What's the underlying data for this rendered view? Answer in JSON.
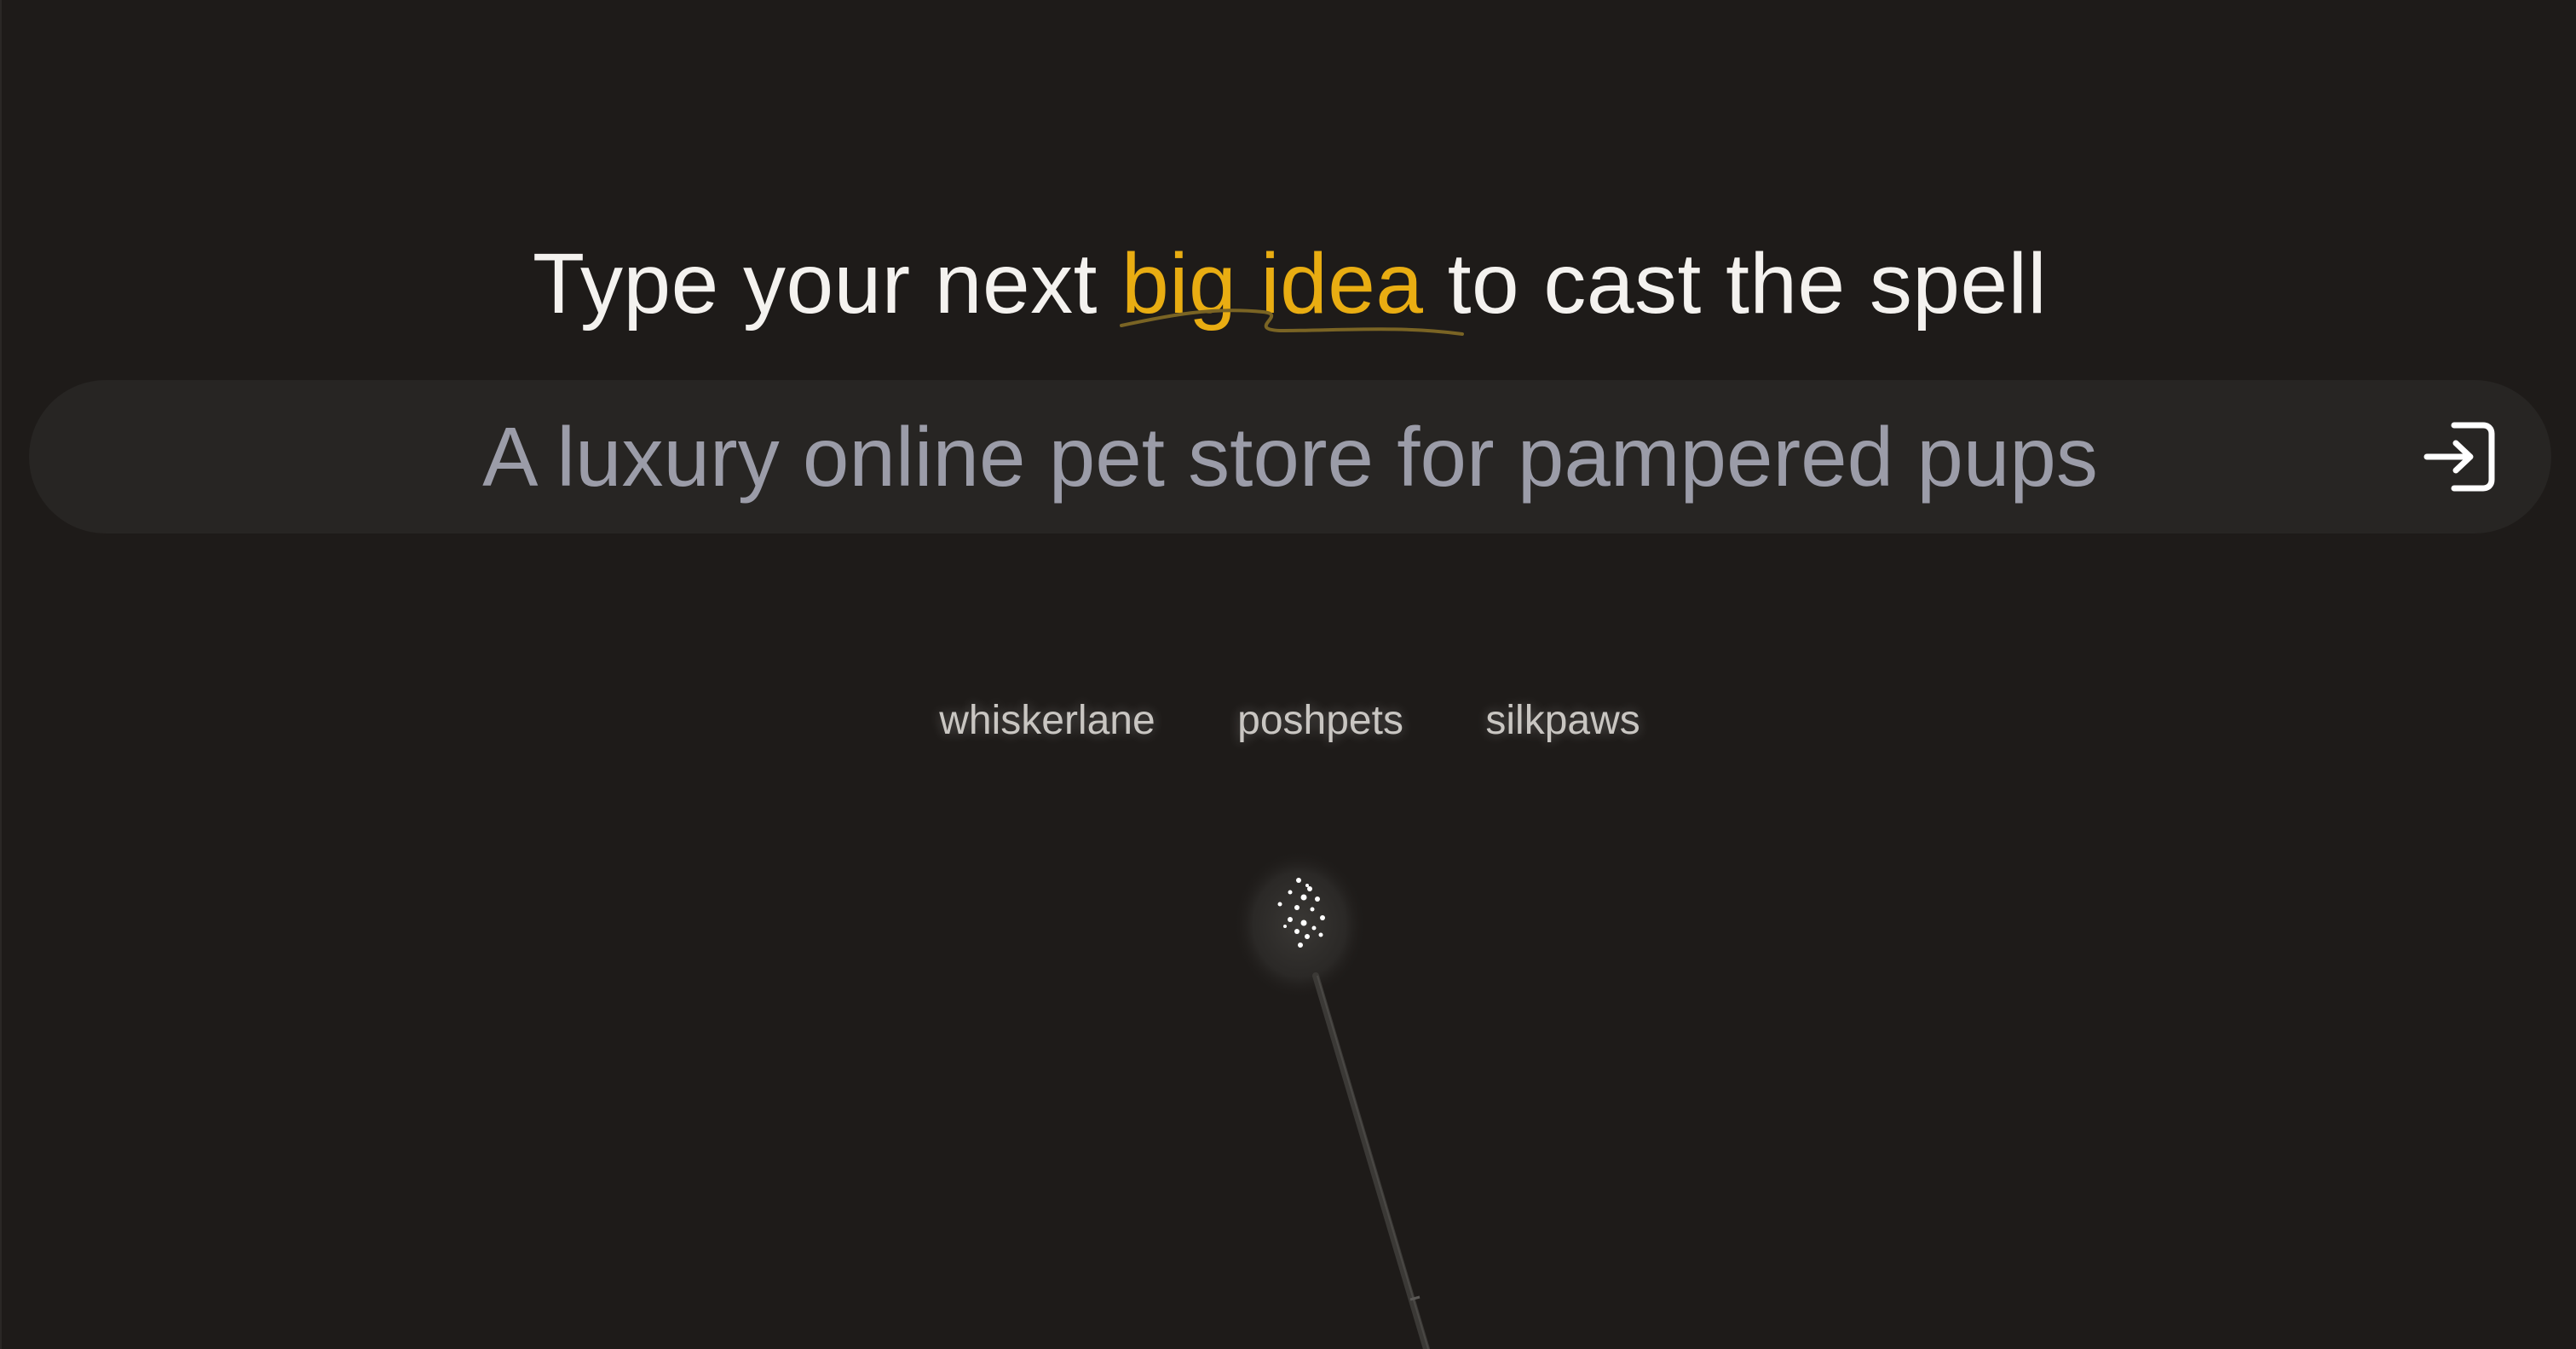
{
  "headline": {
    "before": "Type your next ",
    "highlight": "big idea",
    "after": " to cast the spell"
  },
  "search": {
    "placeholder": "A luxury online pet store for pampered pups",
    "value": ""
  },
  "submit": {
    "icon": "login-arrow-icon"
  },
  "suggestions": [
    "whiskerlane",
    "poshpets",
    "silkpaws"
  ],
  "colors": {
    "background": "#1e1b19",
    "accent": "#e9ad12",
    "search_bar": "#272523",
    "placeholder": "#9b9ca8",
    "suggestion_text": "#c9c6c2"
  }
}
